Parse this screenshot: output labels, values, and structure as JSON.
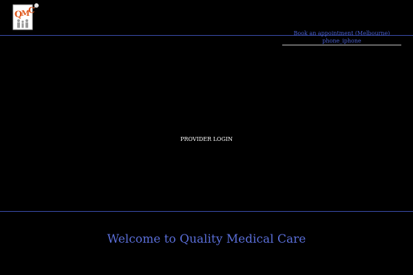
{
  "header": {
    "logo": {
      "text": "QMC"
    },
    "book_appointment": "Book an appointment (Melbourne)",
    "phone": "phone_iphone"
  },
  "main": {
    "provider_login": "PROVIDER LOGIN",
    "welcome_title": "Welcome to Quality Medical Care"
  },
  "colors": {
    "background": "#000000",
    "link": "#4a5fd0",
    "divider": "#3b4fb0",
    "logo_orange": "#e0581c"
  }
}
